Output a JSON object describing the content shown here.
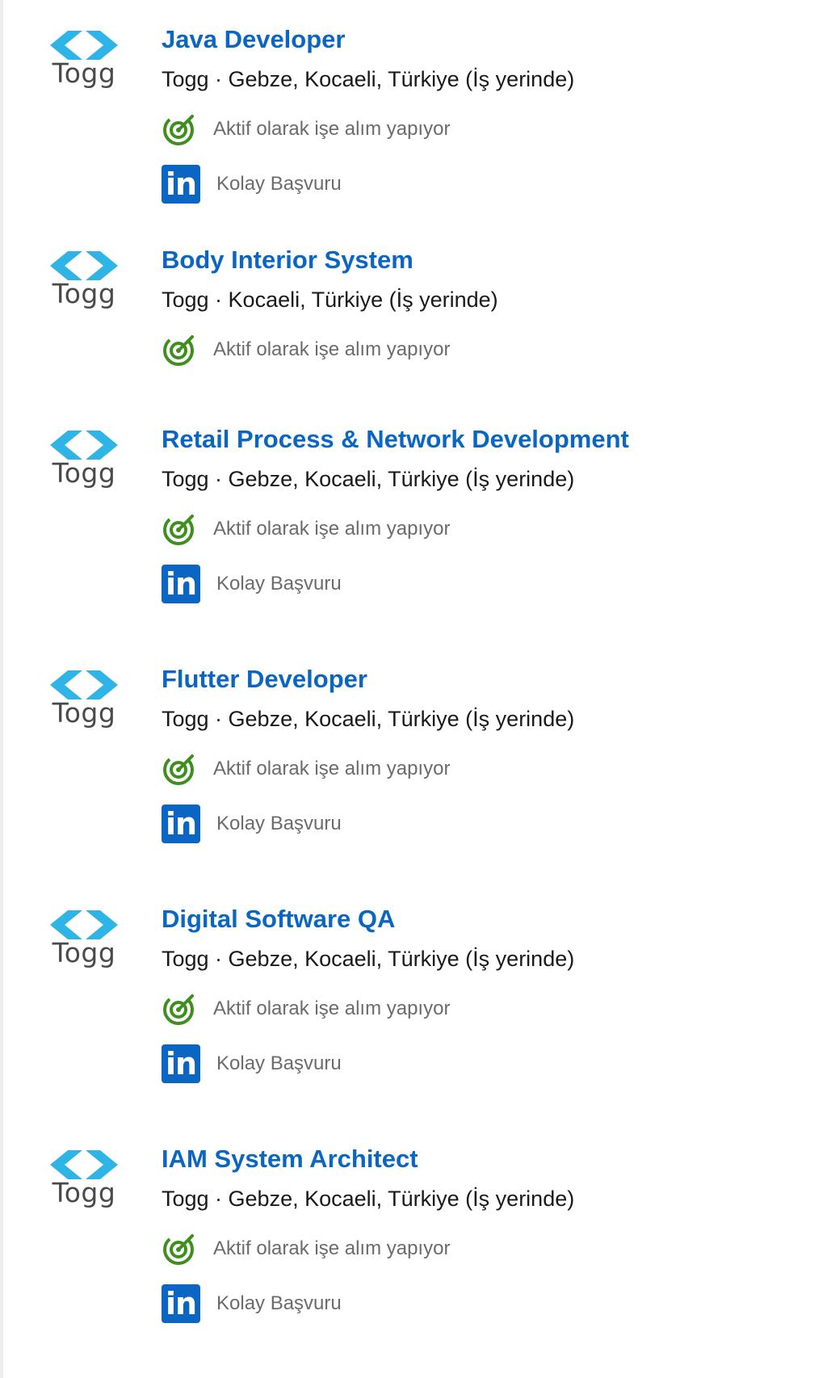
{
  "jobs": [
    {
      "title": "Java Developer",
      "company_line": "Togg · Gebze, Kocaeli, Türkiye (İş yerinde)",
      "logo_text": "Togg",
      "active_text": "Aktif olarak işe alım yapıyor",
      "easy_apply_text": "Kolay Başvuru"
    },
    {
      "title": "Body Interior System",
      "company_line": "Togg · Kocaeli, Türkiye (İş yerinde)",
      "logo_text": "Togg",
      "active_text": "Aktif olarak işe alım yapıyor"
    },
    {
      "title": "Retail Process & Network Development",
      "company_line": "Togg · Gebze, Kocaeli, Türkiye (İş yerinde)",
      "logo_text": "Togg",
      "active_text": "Aktif olarak işe alım yapıyor",
      "easy_apply_text": "Kolay Başvuru"
    },
    {
      "title": "Flutter Developer",
      "company_line": "Togg · Gebze, Kocaeli, Türkiye (İş yerinde)",
      "logo_text": "Togg",
      "active_text": "Aktif olarak işe alım yapıyor",
      "easy_apply_text": "Kolay Başvuru"
    },
    {
      "title": "Digital Software QA",
      "company_line": "Togg · Gebze, Kocaeli, Türkiye (İş yerinde)",
      "logo_text": "Togg",
      "active_text": "Aktif olarak işe alım yapıyor",
      "easy_apply_text": "Kolay Başvuru"
    },
    {
      "title": "IAM System Architect",
      "company_line": "Togg · Gebze, Kocaeli, Türkiye (İş yerinde)",
      "logo_text": "Togg",
      "active_text": "Aktif olarak işe alım yapıyor",
      "easy_apply_text": "Kolay Başvuru"
    }
  ],
  "icons": {
    "logo": "togg-logo-icon",
    "active": "target-icon",
    "easy_apply": "linkedin-icon"
  },
  "colors": {
    "title": "#0a66c2",
    "active_icon": "#3f8f1f",
    "linkedin": "#0a66c2",
    "logo_chevron": "#2eb4e6"
  }
}
